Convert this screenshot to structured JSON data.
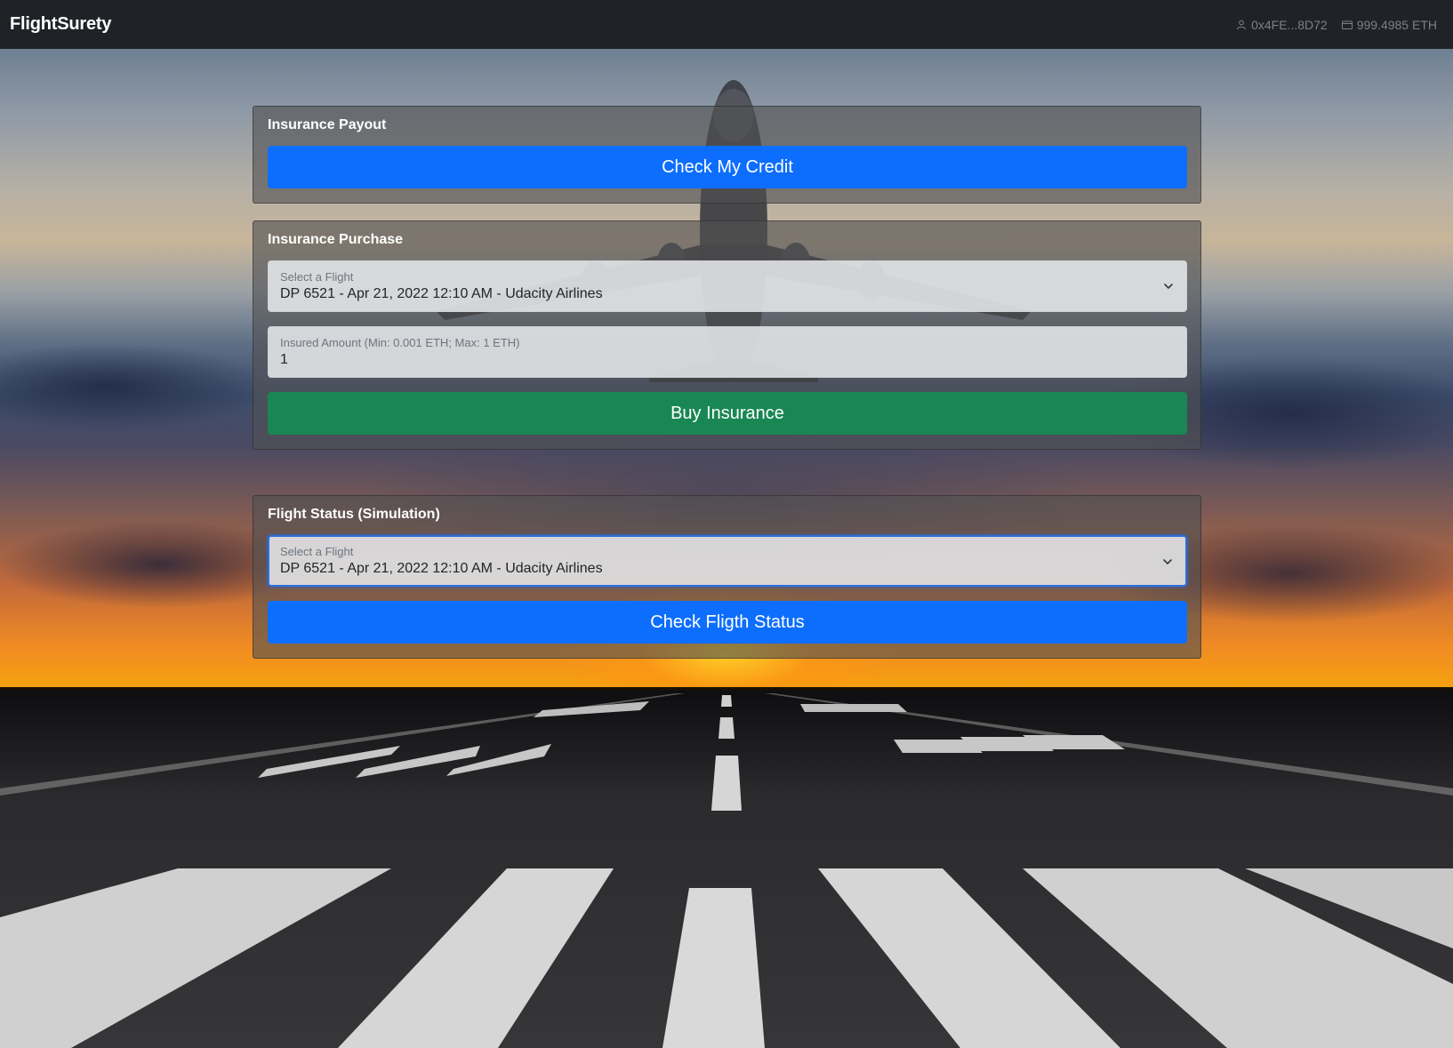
{
  "navbar": {
    "brand": "FlightSurety",
    "account": "0x4FE...8D72",
    "balance": "999.4985 ETH",
    "account_icon": "person-icon",
    "balance_icon": "wallet-icon"
  },
  "payout": {
    "title": "Insurance Payout",
    "button_label": "Check My Credit"
  },
  "purchase": {
    "title": "Insurance Purchase",
    "flight_select": {
      "label": "Select a Flight",
      "value": "DP 6521 - Apr 21, 2022 12:10 AM - Udacity Airlines"
    },
    "amount_input": {
      "label": "Insured Amount (Min: 0.001 ETH; Max: 1 ETH)",
      "value": "1"
    },
    "button_label": "Buy Insurance"
  },
  "status": {
    "title": "Flight Status (Simulation)",
    "flight_select": {
      "label": "Select a Flight",
      "value": "DP 6521 - Apr 21, 2022 12:10 AM - Udacity Airlines"
    },
    "button_label": "Check Fligth Status"
  },
  "colors": {
    "primary": "#0d6efd",
    "success": "#198754",
    "navbar": "#1f2227"
  }
}
